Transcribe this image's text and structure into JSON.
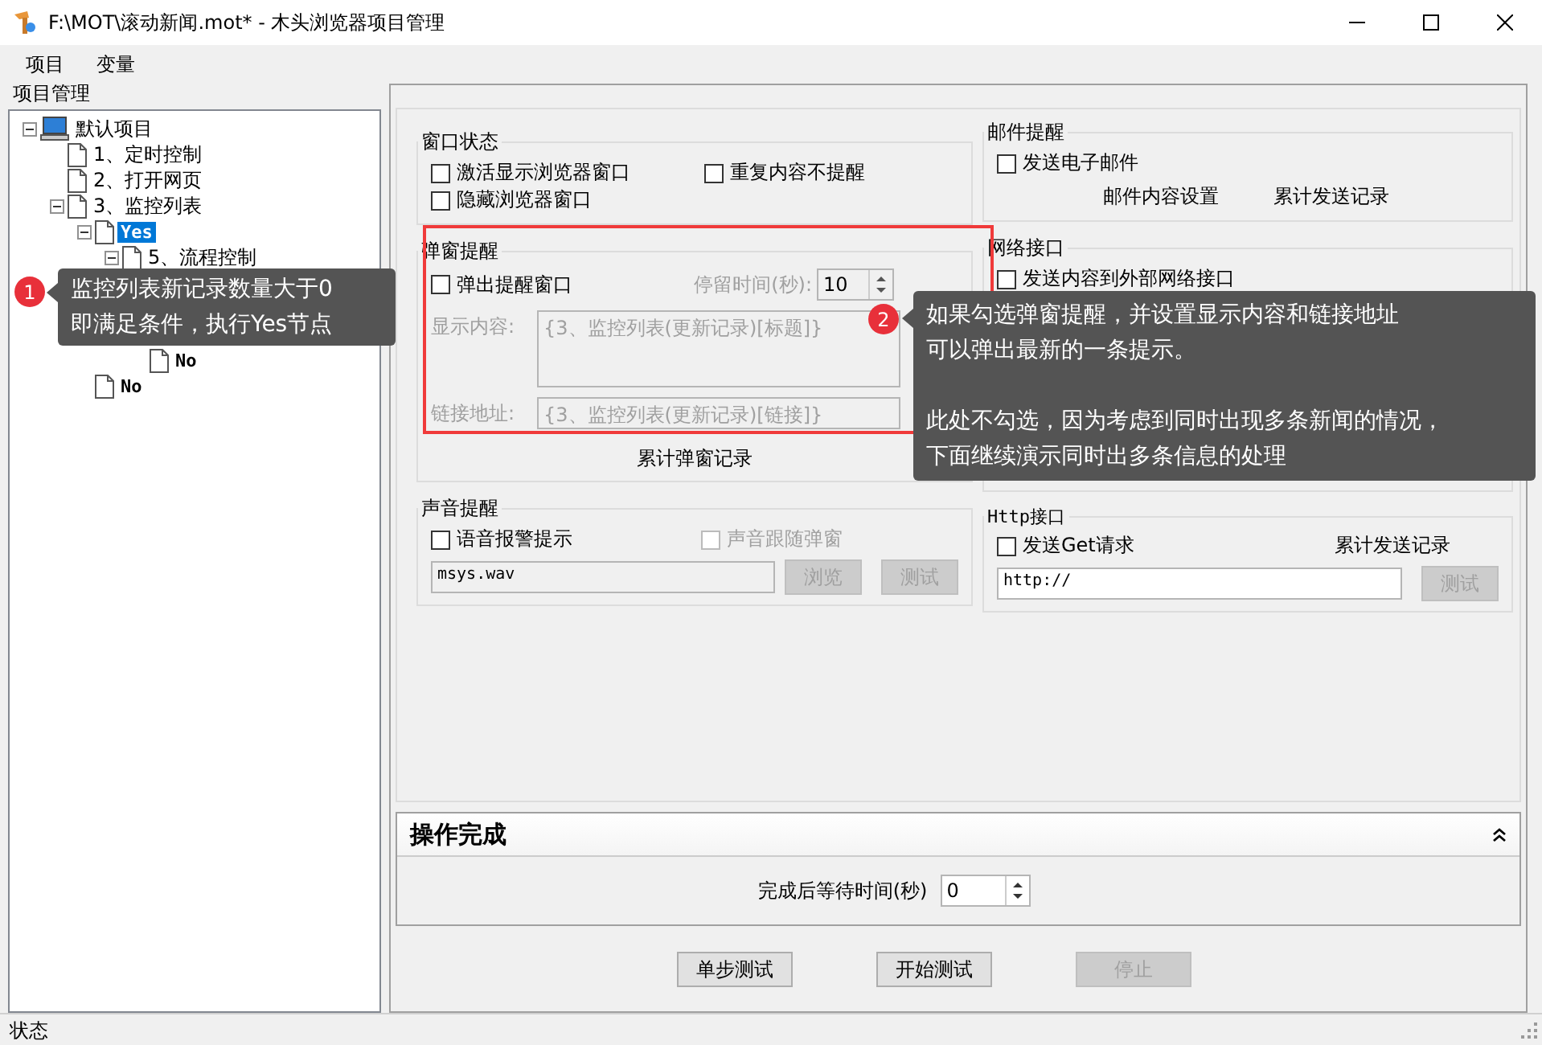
{
  "window": {
    "title": "F:\\MOT\\滚动新闻.mot* - 木头浏览器项目管理"
  },
  "menu": [
    {
      "label": "项目"
    },
    {
      "label": "变量"
    }
  ],
  "sidebar": {
    "title": "项目管理",
    "tree": [
      {
        "label": "默认项目",
        "kind": "project",
        "expanded": true,
        "selected": false,
        "children": [
          {
            "label": "1、定时控制",
            "kind": "page",
            "selected": false
          },
          {
            "label": "2、打开网页",
            "kind": "page",
            "selected": false
          },
          {
            "label": "3、监控列表",
            "kind": "page",
            "expanded": true,
            "selected": false,
            "children": [
              {
                "label": "Yes",
                "kind": "page",
                "expanded": true,
                "selected": true,
                "children": [
                  {
                    "label": "5、流程控制",
                    "kind": "page",
                    "expanded": true,
                    "selected": false,
                    "children": [
                      {
                        "label": "No",
                        "kind": "page",
                        "selected": false
                      }
                    ]
                  }
                ]
              },
              {
                "label": "No",
                "kind": "page",
                "selected": false
              }
            ]
          }
        ]
      }
    ]
  },
  "window_state": {
    "title": "窗口状态",
    "checkboxes": [
      {
        "label": "激活显示浏览器窗口",
        "checked": false
      },
      {
        "label": "重复内容不提醒",
        "checked": false
      },
      {
        "label": "隐藏浏览器窗口",
        "checked": false
      }
    ]
  },
  "popup_alert": {
    "title": "弹窗提醒",
    "checkbox": {
      "label": "弹出提醒窗口",
      "checked": false
    },
    "stay_time_label": "停留时间(秒):",
    "stay_time_value": "10",
    "content_label": "显示内容:",
    "content_value": "{3、监控列表(更新记录)[标题]}",
    "link_label": "链接地址:",
    "link_value": "{3、监控列表(更新记录)[链接]}",
    "record_link": "累计弹窗记录"
  },
  "sound_alert": {
    "title": "声音提醒",
    "checkbox": {
      "label": "语音报警提示",
      "checked": false
    },
    "follow_checkbox": {
      "label": "声音跟随弹窗",
      "checked": false,
      "disabled": true
    },
    "file_value": "msys.wav",
    "browse_button": "浏览",
    "test_button": "测试"
  },
  "mail_alert": {
    "title": "邮件提醒",
    "checkbox": {
      "label": "发送电子邮件",
      "checked": false
    },
    "links": [
      "邮件内容设置",
      "累计发送记录"
    ]
  },
  "network": {
    "title": "网络接口",
    "checkbox": {
      "label": "发送内容到外部网络接口",
      "checked": false
    }
  },
  "http": {
    "title": "Http接口",
    "checkbox": {
      "label": "发送Get请求",
      "checked": false
    },
    "record_link": "累计发送记录",
    "url_value": "http://",
    "test_button": "测试"
  },
  "completion": {
    "title": "操作完成",
    "expanded": true,
    "wait_label": "完成后等待时间(秒)",
    "wait_value": "0"
  },
  "buttons": [
    {
      "label": "单步测试",
      "disabled": false
    },
    {
      "label": "开始测试",
      "disabled": false
    },
    {
      "label": "停止",
      "disabled": true
    }
  ],
  "status_bar": "状态",
  "annotations": [
    {
      "number": "1",
      "paragraphs": [
        [
          "监控列表新记录数量大于0",
          "即满足条件，执行Yes节点"
        ]
      ]
    },
    {
      "number": "2",
      "paragraphs": [
        [
          "如果勾选弹窗提醒，并设置显示内容和链接地址",
          "可以弹出最新的一条提示。"
        ],
        [
          "此处不勾选，因为考虑到同时出现多条新闻的情况，",
          "下面继续演示同时出多条信息的处理"
        ]
      ]
    }
  ]
}
